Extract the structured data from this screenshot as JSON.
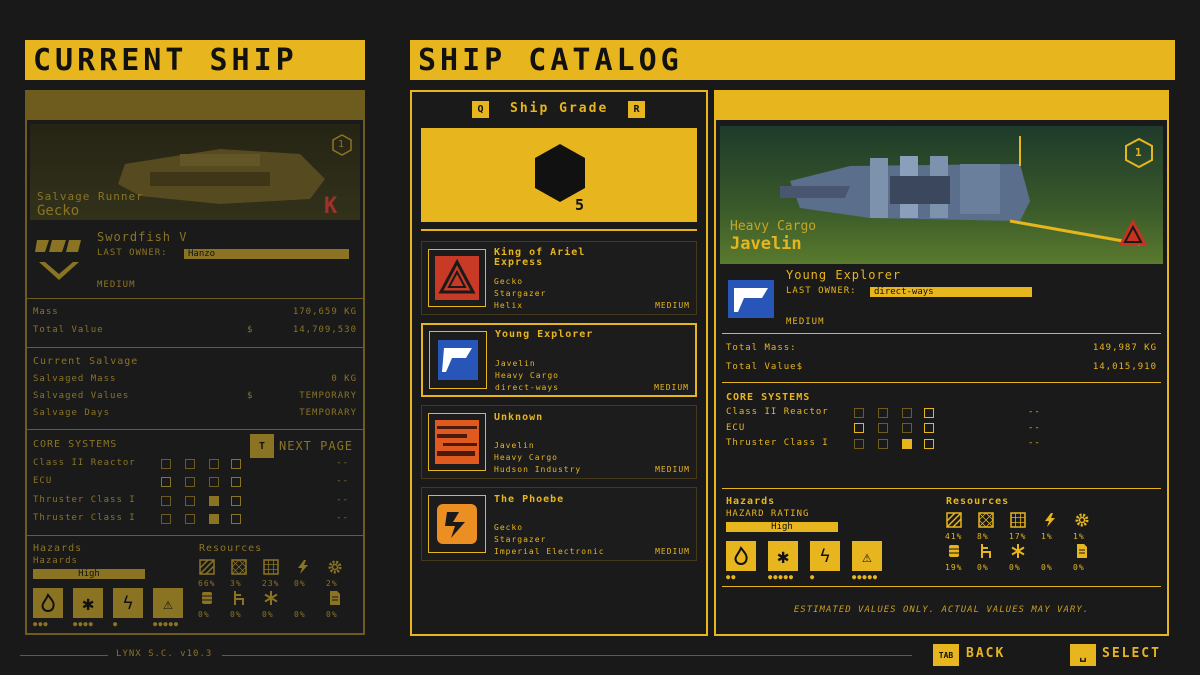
{
  "current_ship": {
    "title": "CURRENT SHIP",
    "class": "Salvage Runner",
    "model": "Gecko",
    "grade": "1",
    "name": "Swordfish V",
    "last_owner_label": "LAST OWNER:",
    "last_owner": "Hanzo",
    "size": "MEDIUM",
    "mass_label": "Mass",
    "mass_value": "170,659 KG",
    "total_value_label": "Total Value",
    "currency": "$",
    "total_value": "14,709,530",
    "salvage_title": "Current Salvage",
    "salvaged_mass_label": "Salvaged Mass",
    "salvaged_mass": "0 KG",
    "salvaged_values_label": "Salvaged Values",
    "salvaged_values": "TEMPORARY",
    "salvage_days_label": "Salvage Days",
    "salvage_days": "TEMPORARY",
    "core_title": "CORE SYSTEMS",
    "next_key": "T",
    "next_label": "NEXT PAGE",
    "systems": [
      {
        "name": "Class II Reactor",
        "value": "--"
      },
      {
        "name": "ECU",
        "value": "--"
      },
      {
        "name": "Thruster Class I",
        "value": "--"
      },
      {
        "name": "Thruster Class I",
        "value": "--"
      }
    ],
    "hazards_title": "Hazards",
    "hazards_sub": "Hazards",
    "hazard_rating": "High",
    "resources_title": "Resources",
    "resources": [
      {
        "icon": "hatched-square-icon",
        "pct": "66%"
      },
      {
        "icon": "crosshatch-square-icon",
        "pct": "3%"
      },
      {
        "icon": "grid-square-icon",
        "pct": "23%"
      },
      {
        "icon": "lightning-icon",
        "pct": "0%"
      },
      {
        "icon": "gear-icon",
        "pct": "2%"
      },
      {
        "icon": "barrel-icon",
        "pct": "0%"
      },
      {
        "icon": "chair-icon",
        "pct": "0%"
      },
      {
        "icon": "snowflake-icon",
        "pct": "0%"
      },
      {
        "icon": "droplet-icon",
        "pct": "0%"
      },
      {
        "icon": "document-icon",
        "pct": "0%"
      }
    ]
  },
  "catalog": {
    "title": "SHIP CATALOG",
    "grade_key_left": "Q",
    "grade_label": "Ship Grade",
    "grade_key_right": "R",
    "grade_value": "5",
    "ships": [
      {
        "name": "King of Ariel Express",
        "line1": "Gecko",
        "line2": "Stargazer",
        "line3": "Helix",
        "size": "MEDIUM"
      },
      {
        "name": "Young Explorer",
        "line1": "Javelin",
        "line2": "Heavy Cargo",
        "line3": "direct-ways",
        "size": "MEDIUM"
      },
      {
        "name": "Unknown",
        "line1": "Javelin",
        "line2": "Heavy Cargo",
        "line3": "Hudson Industry",
        "size": "MEDIUM"
      },
      {
        "name": "The Phoebe",
        "line1": "Gecko",
        "line2": "Stargazer",
        "line3": "Imperial Electronic",
        "size": "MEDIUM"
      }
    ]
  },
  "detail": {
    "class": "Heavy Cargo",
    "model": "Javelin",
    "grade": "1",
    "name": "Young Explorer",
    "last_owner_label": "LAST OWNER:",
    "last_owner": "direct-ways",
    "size": "MEDIUM",
    "mass_label": "Total Mass:",
    "mass_value": "149,987 KG",
    "value_label": "Total Value$",
    "value": "14,015,910",
    "core_title": "CORE SYSTEMS",
    "systems": [
      {
        "name": "Class II Reactor",
        "value": "--"
      },
      {
        "name": "ECU",
        "value": "--"
      },
      {
        "name": "Thruster Class I",
        "value": "--"
      }
    ],
    "hazards_title": "Hazards",
    "hazard_rating_label": "HAZARD RATING",
    "hazard_rating": "High",
    "resources_title": "Resources",
    "resources": [
      {
        "icon": "hatched-square-icon",
        "pct": "41%"
      },
      {
        "icon": "crosshatch-square-icon",
        "pct": "8%"
      },
      {
        "icon": "grid-square-icon",
        "pct": "17%"
      },
      {
        "icon": "lightning-icon",
        "pct": "1%"
      },
      {
        "icon": "gear-icon",
        "pct": "1%"
      },
      {
        "icon": "barrel-icon",
        "pct": "19%"
      },
      {
        "icon": "chair-icon",
        "pct": "0%"
      },
      {
        "icon": "snowflake-icon",
        "pct": "0%"
      },
      {
        "icon": "droplet-icon",
        "pct": "0%"
      },
      {
        "icon": "document-icon",
        "pct": "0%"
      }
    ],
    "disclaimer": "ESTIMATED VALUES ONLY. ACTUAL VALUES MAY VARY."
  },
  "footer": {
    "version": "LYNX S.C. v10.3",
    "back_key": "TAB",
    "back_label": "BACK",
    "select_key": "␣",
    "select_label": "SELECT"
  },
  "colors": {
    "accent": "#e7b51d",
    "background": "#191919",
    "dim": "#8a7424"
  }
}
